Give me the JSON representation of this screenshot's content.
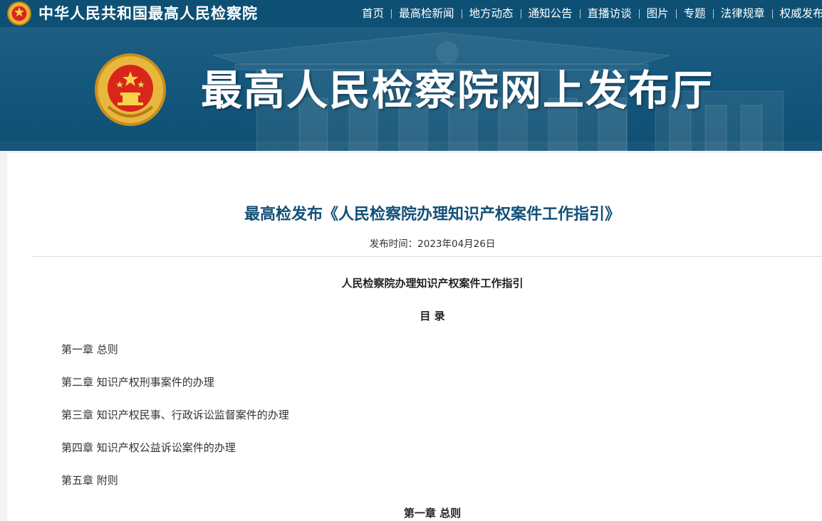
{
  "site": {
    "name": "中华人民共和国最高人民检察院",
    "nav": [
      "首页",
      "最高检新闻",
      "地方动态",
      "通知公告",
      "直播访谈",
      "图片",
      "专题",
      "法律规章",
      "权威发布"
    ]
  },
  "banner": {
    "title": "最高人民检察院网上发布厅",
    "emblem_top_text": "中国检察",
    "emblem_ring_text": "ZHONGGUO JIANCHA"
  },
  "article": {
    "title": "最高检发布《人民检察院办理知识产权案件工作指引》",
    "meta": "发布时间：2023年04月26日",
    "doc_title": "人民检察院办理知识产权案件工作指引",
    "toc_heading": "目 录",
    "toc": [
      "第一章 总则",
      "第二章 知识产权刑事案件的办理",
      "第三章 知识产权民事、行政诉讼监督案件的办理",
      "第四章 知识产权公益诉讼案件的办理",
      "第五章 附则"
    ],
    "chapter1_heading": "第一章 总则"
  },
  "colors": {
    "brand_blue": "#0d5074",
    "title_blue": "#134f77",
    "emblem_red": "#d8261c",
    "emblem_gold": "#e6b23b"
  }
}
